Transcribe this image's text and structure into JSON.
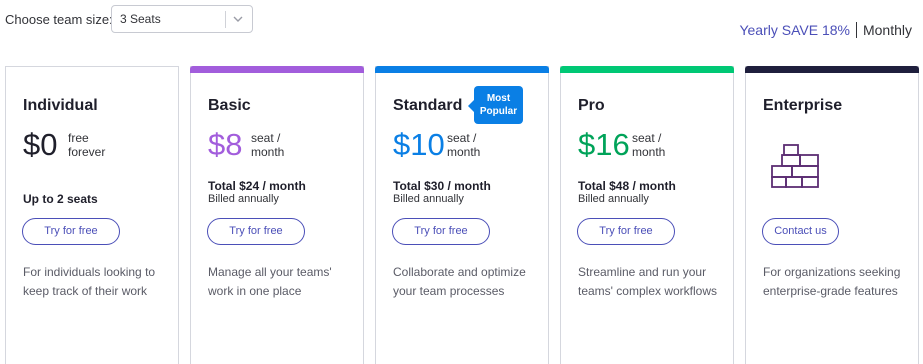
{
  "team_size": {
    "label": "Choose team size:",
    "selected": "3 Seats"
  },
  "billing_toggle": {
    "yearly": "Yearly SAVE 18%",
    "monthly": "Monthly"
  },
  "colors": {
    "individual": "#ffffff",
    "basic": "#a25ddc",
    "standard": "#0a7fe5",
    "pro": "#00c875",
    "enterprise": "#1f1f3d",
    "button": "#4b4fb8"
  },
  "plans": [
    {
      "name": "Individual",
      "price": "$0",
      "unit_line1": "free",
      "unit_line2": "forever",
      "seats": "Up to 2 seats",
      "button": "Try for free",
      "description": "For individuals looking to keep track of their work"
    },
    {
      "name": "Basic",
      "price": "$8",
      "unit_line1": "seat /",
      "unit_line2": "month",
      "total": "Total $24 / month",
      "billed": "Billed annually",
      "button": "Try for free",
      "description": "Manage all your teams' work in one place"
    },
    {
      "name": "Standard",
      "badge": "Most Popular",
      "price": "$10",
      "unit_line1": "seat /",
      "unit_line2": "month",
      "total": "Total $30 / month",
      "billed": "Billed annually",
      "button": "Try for free",
      "description": "Collaborate and optimize your team processes"
    },
    {
      "name": "Pro",
      "price": "$16",
      "unit_line1": "seat /",
      "unit_line2": "month",
      "total": "Total $48 / month",
      "billed": "Billed annually",
      "button": "Try for free",
      "description": "Streamline and run your teams' complex workflows"
    },
    {
      "name": "Enterprise",
      "icon": "building-blocks-icon",
      "button": "Contact us",
      "description": "For organizations seeking enterprise-grade features"
    }
  ]
}
